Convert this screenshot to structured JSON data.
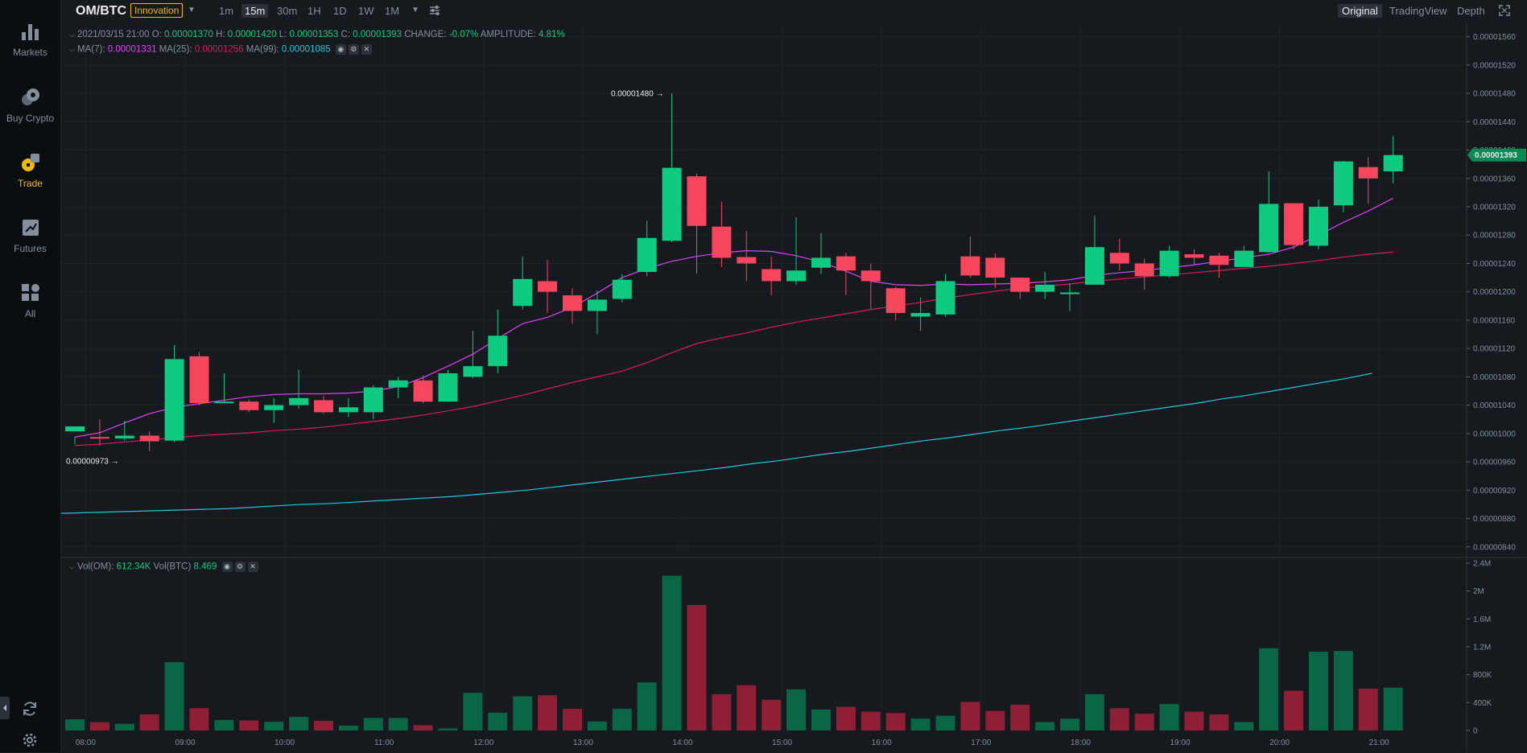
{
  "sidebar": {
    "items": [
      {
        "label": "Markets",
        "icon": "bar-chart-icon"
      },
      {
        "label": "Buy Crypto",
        "icon": "coins-icon"
      },
      {
        "label": "Trade",
        "icon": "trade-icon",
        "active": true
      },
      {
        "label": "Futures",
        "icon": "futures-icon"
      },
      {
        "label": "All",
        "icon": "grid-icon"
      }
    ],
    "bottom_icons": [
      "refresh-icon",
      "settings-icon"
    ]
  },
  "toolbar": {
    "pair": "OM/BTC",
    "badge": "Innovation",
    "intervals": [
      "1m",
      "15m",
      "30m",
      "1H",
      "1D",
      "1W",
      "1M"
    ],
    "active_interval": "15m",
    "views": [
      "Original",
      "TradingView",
      "Depth"
    ],
    "active_view": "Original"
  },
  "legend": {
    "date": "2021/03/15 21:00",
    "o_label": "O:",
    "o_value": "0.00001370",
    "h_label": "H:",
    "h_value": "0.00001420",
    "l_label": "L:",
    "l_value": "0.00001353",
    "c_label": "C:",
    "c_value": "0.00001393",
    "change_label": "CHANGE:",
    "change_value": "-0.07%",
    "amplitude_label": "AMPLITUDE:",
    "amplitude_value": "4.81%",
    "ma7_label": "MA(7):",
    "ma7_value": "0.00001331",
    "ma25_label": "MA(25):",
    "ma25_value": "0.00001256",
    "ma99_label": "MA(99):",
    "ma99_value": "0.00001085",
    "vol_om_label": "Vol(OM):",
    "vol_om_value": "612.34K",
    "vol_btc_label": "Vol(BTC)",
    "vol_btc_value": "8.469"
  },
  "colors": {
    "up": "#0ecb81",
    "down": "#f6465d",
    "up_vol": "#0b6645",
    "down_vol": "#8f1f34",
    "ma7": "#e040fb",
    "ma25": "#d81b60",
    "ma99": "#26c6da",
    "bg": "#161a1e",
    "grid": "#1e2329"
  },
  "chart_data": {
    "type": "candlestick",
    "price_unit_scale": 1e-08,
    "x_ticks": [
      "08:00",
      "09:00",
      "10:00",
      "11:00",
      "12:00",
      "13:00",
      "14:00",
      "15:00",
      "16:00",
      "17:00",
      "18:00",
      "19:00",
      "20:00",
      "21:00"
    ],
    "y_ticks": [
      "0.00000840",
      "0.00000880",
      "0.00000920",
      "0.00000960",
      "0.00001000",
      "0.00001040",
      "0.00001080",
      "0.00001120",
      "0.00001160",
      "0.00001200",
      "0.00001240",
      "0.00001280",
      "0.00001320",
      "0.00001360",
      "0.00001400",
      "0.00001440",
      "0.00001480",
      "0.00001520",
      "0.00001560"
    ],
    "ylim": [
      825,
      1580
    ],
    "current_price": "0.00001393",
    "high_annotation": "0.00001480",
    "low_annotation": "0.00000973",
    "vol_ticks": [
      "0",
      "400K",
      "800K",
      "1.2M",
      "1.6M",
      "2M",
      "2.4M"
    ],
    "vol_ylim": [
      0,
      2400
    ],
    "candles": [
      [
        1003,
        1010,
        985,
        995
      ],
      [
        995,
        993,
        1020,
        983
      ],
      [
        993,
        997,
        1018,
        990
      ],
      [
        997,
        989,
        1003,
        975
      ],
      [
        990,
        1105,
        1125,
        988
      ],
      [
        1109,
        1043,
        1115,
        1040
      ],
      [
        1045,
        1045,
        1085,
        1043
      ],
      [
        1045,
        1033,
        1048,
        1030
      ],
      [
        1033,
        1040,
        1050,
        1015
      ],
      [
        1040,
        1050,
        1090,
        1035
      ],
      [
        1047,
        1030,
        1053,
        1028
      ],
      [
        1030,
        1037,
        1050,
        1023
      ],
      [
        1030,
        1065,
        1068,
        1020
      ],
      [
        1065,
        1075,
        1080,
        1050
      ],
      [
        1075,
        1045,
        1082,
        1043
      ],
      [
        1045,
        1085,
        1090,
        1045
      ],
      [
        1080,
        1095,
        1145,
        1078
      ],
      [
        1095,
        1138,
        1175,
        1085
      ],
      [
        1180,
        1218,
        1250,
        1175
      ],
      [
        1215,
        1200,
        1245,
        1170
      ],
      [
        1195,
        1173,
        1205,
        1155
      ],
      [
        1173,
        1189,
        1202,
        1140
      ],
      [
        1190,
        1217,
        1225,
        1185
      ],
      [
        1228,
        1276,
        1300,
        1222
      ],
      [
        1272,
        1375,
        1480,
        1270
      ],
      [
        1363,
        1293,
        1367,
        1226
      ],
      [
        1292,
        1248,
        1327,
        1235
      ],
      [
        1249,
        1240,
        1286,
        1215
      ],
      [
        1232,
        1215,
        1250,
        1195
      ],
      [
        1215,
        1230,
        1305,
        1210
      ],
      [
        1234,
        1248,
        1283,
        1225
      ],
      [
        1250,
        1230,
        1255,
        1195
      ],
      [
        1230,
        1215,
        1240,
        1175
      ],
      [
        1205,
        1170,
        1207,
        1160
      ],
      [
        1165,
        1170,
        1192,
        1145
      ],
      [
        1168,
        1215,
        1225,
        1165
      ],
      [
        1250,
        1223,
        1278,
        1220
      ],
      [
        1248,
        1220,
        1254,
        1205
      ],
      [
        1220,
        1200,
        1220,
        1190
      ],
      [
        1200,
        1210,
        1228,
        1190
      ],
      [
        1198,
        1199,
        1212,
        1173
      ],
      [
        1210,
        1263,
        1307,
        1210
      ],
      [
        1255,
        1240,
        1275,
        1230
      ],
      [
        1240,
        1222,
        1247,
        1203
      ],
      [
        1222,
        1258,
        1265,
        1220
      ],
      [
        1253,
        1248,
        1260,
        1238
      ],
      [
        1251,
        1238,
        1255,
        1220
      ],
      [
        1235,
        1258,
        1265,
        1235
      ],
      [
        1256,
        1324,
        1370,
        1255
      ],
      [
        1325,
        1266,
        1325,
        1260
      ],
      [
        1265,
        1320,
        1330,
        1260
      ],
      [
        1322,
        1384,
        1385,
        1312
      ],
      [
        1376,
        1360,
        1390,
        1324
      ],
      [
        1370,
        1393,
        1420,
        1353
      ]
    ],
    "volumes": [
      160,
      120,
      95,
      230,
      980,
      320,
      150,
      145,
      125,
      195,
      140,
      70,
      180,
      180,
      75,
      30,
      540,
      255,
      490,
      505,
      310,
      130,
      310,
      690,
      2220,
      1800,
      520,
      650,
      440,
      590,
      300,
      340,
      270,
      250,
      170,
      210,
      410,
      280,
      370,
      120,
      170,
      520,
      320,
      240,
      380,
      270,
      230,
      120,
      1180,
      570,
      1130,
      1140,
      600,
      615
    ],
    "ma7": [
      987,
      988,
      990,
      992,
      995,
      1001,
      1015,
      1028,
      1037,
      1042,
      1047,
      1052,
      1055,
      1056,
      1056,
      1057,
      1060,
      1066,
      1079,
      1095,
      1112,
      1134,
      1155,
      1164,
      1178,
      1198,
      1220,
      1233,
      1243,
      1250,
      1255,
      1258,
      1257,
      1251,
      1242,
      1229,
      1215,
      1210,
      1209,
      1211,
      1210,
      1211,
      1212,
      1214,
      1217,
      1223,
      1227,
      1230,
      1234,
      1238,
      1243,
      1248,
      1253,
      1263,
      1280,
      1298,
      1314,
      1332
    ],
    "ma25": [
      983,
      985,
      988,
      991,
      994,
      997,
      999,
      1001,
      1004,
      1006,
      1009,
      1013,
      1017,
      1021,
      1026,
      1032,
      1038,
      1046,
      1054,
      1063,
      1072,
      1080,
      1088,
      1100,
      1114,
      1127,
      1135,
      1142,
      1150,
      1157,
      1163,
      1169,
      1175,
      1180,
      1185,
      1191,
      1196,
      1201,
      1205,
      1208,
      1211,
      1215,
      1218,
      1221,
      1224,
      1227,
      1230,
      1233,
      1236,
      1240,
      1244,
      1249,
      1253,
      1256
    ],
    "ma99": [
      887,
      888,
      889,
      890,
      891,
      892,
      893,
      894,
      896,
      898,
      900,
      901,
      903,
      905,
      907,
      909,
      911,
      914,
      917,
      920,
      924,
      928,
      932,
      936,
      940,
      944,
      948,
      952,
      957,
      961,
      966,
      971,
      975,
      980,
      985,
      990,
      994,
      999,
      1004,
      1008,
      1013,
      1018,
      1023,
      1028,
      1033,
      1038,
      1043,
      1049,
      1054,
      1060,
      1066,
      1072,
      1078,
      1085
    ]
  }
}
